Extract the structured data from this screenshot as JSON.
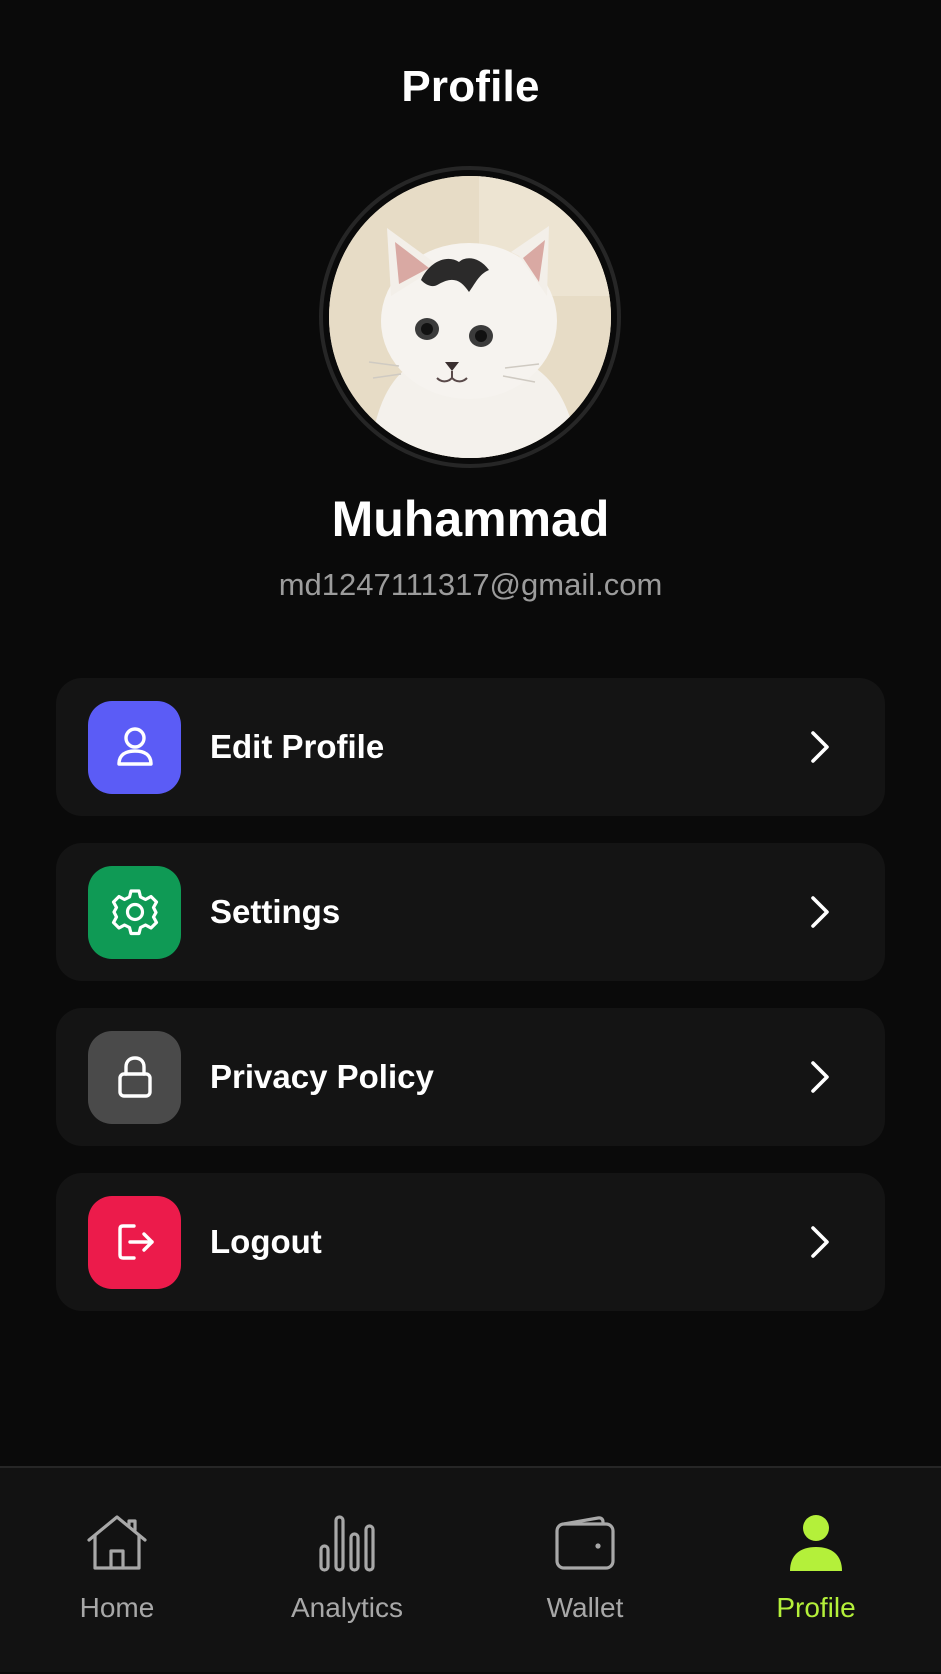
{
  "header": {
    "title": "Profile"
  },
  "user": {
    "name": "Muhammad",
    "email": "md1247111317@gmail.com"
  },
  "menu": [
    {
      "label": "Edit Profile",
      "icon": "user-icon",
      "color": "#5b5cf6"
    },
    {
      "label": "Settings",
      "icon": "gear-icon",
      "color": "#0f9a55"
    },
    {
      "label": "Privacy Policy",
      "icon": "lock-icon",
      "color": "#4a4a4a"
    },
    {
      "label": "Logout",
      "icon": "logout-icon",
      "color": "#ec1b4b"
    }
  ],
  "bottom_nav": [
    {
      "label": "Home",
      "icon": "home-icon",
      "active": false
    },
    {
      "label": "Analytics",
      "icon": "bar-chart-icon",
      "active": false
    },
    {
      "label": "Wallet",
      "icon": "wallet-icon",
      "active": false
    },
    {
      "label": "Profile",
      "icon": "user-icon",
      "active": true
    }
  ],
  "colors": {
    "background": "#0a0a0a",
    "card": "#141414",
    "accent": "#b4f03a",
    "muted_text": "#9c9c9c"
  }
}
